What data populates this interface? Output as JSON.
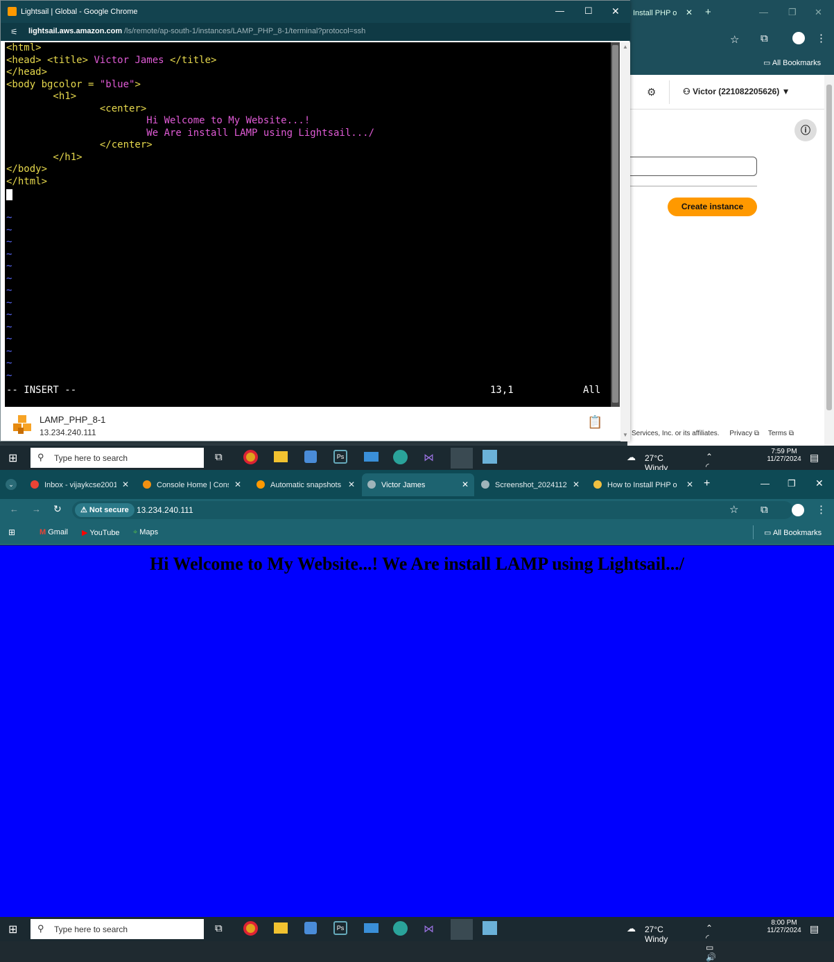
{
  "top_popup": {
    "window_title": "Lightsail | Global - Google Chrome",
    "controls": [
      "—",
      "☐",
      "✕"
    ],
    "url_host": "lightsail.aws.amazon.com",
    "url_path": "/ls/remote/ap-south-1/instances/LAMP_PHP_8-1/terminal?protocol=ssh",
    "terminal": {
      "lines": [
        [
          "<html>"
        ],
        [
          "<head> <title> ",
          "Victor James",
          " </title>"
        ],
        [
          "</head>"
        ],
        [
          "<body bgcolor = ",
          "\"blue\"",
          ">"
        ],
        [
          "        <h1>"
        ],
        [
          "                <center>"
        ],
        [
          "                        Hi Welcome to My Website...!"
        ],
        [
          "                        We Are install LAMP using Lightsail.../"
        ],
        [
          "                </center>"
        ],
        [
          "        </h1>"
        ],
        [
          "</body>"
        ],
        [
          "</html>"
        ]
      ],
      "tilde": "~",
      "mode": "-- INSERT --",
      "position": "13,1",
      "scope": "All"
    },
    "instance_name": "LAMP_PHP_8-1",
    "instance_ip": "13.234.240.111"
  },
  "bg_window": {
    "tab_label": "Install PHP o",
    "user_label": "Victor (221082205626)",
    "all_bookmarks": "All Bookmarks",
    "create_button": "Create instance",
    "footer_text": "Services, Inc. or its affiliates.",
    "privacy": "Privacy",
    "terms": "Terms"
  },
  "taskbar_top": {
    "search": "Type here to search",
    "weather": "27°C  Windy",
    "time": "7:59 PM",
    "date": "11/27/2024"
  },
  "taskbar_bottom": {
    "search": "Type here to search",
    "weather": "27°C  Windy",
    "time": "8:00 PM",
    "date": "11/27/2024"
  },
  "browser": {
    "tabs": [
      {
        "label": "Inbox - vijaykcse2001",
        "icon": "gmail-icon"
      },
      {
        "label": "Console Home | Cons",
        "icon": "aws-icon"
      },
      {
        "label": "Automatic snapshots",
        "icon": "lightsail-icon"
      },
      {
        "label": "Victor James",
        "icon": "globe-icon",
        "active": true
      },
      {
        "label": "Screenshot_2024112",
        "icon": "globe-icon"
      },
      {
        "label": "How to Install PHP o",
        "icon": "linux-icon"
      }
    ],
    "not_secure": "Not secure",
    "url": "13.234.240.111",
    "bookmarks": [
      "Gmail",
      "YouTube",
      "Maps"
    ],
    "all_bookmarks": "All Bookmarks",
    "page_heading": "Hi Welcome to My Website...! We Are install LAMP using Lightsail.../"
  },
  "colors": {
    "page_bg": "#0000fe",
    "accent_orange": "#ff9900",
    "term_yellow": "#e7d94d",
    "term_magenta": "#e05bd6"
  }
}
